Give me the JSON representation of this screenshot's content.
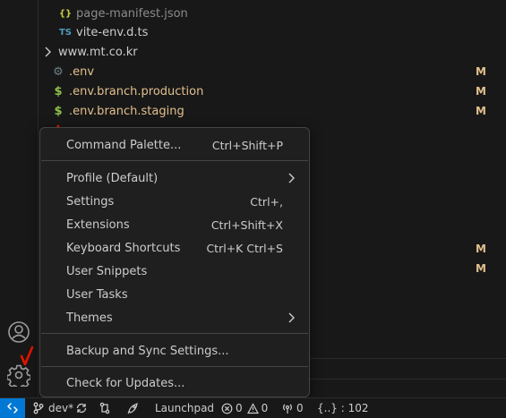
{
  "explorer": {
    "files": [
      {
        "name": "page-manifest.json",
        "icon": "json-icon",
        "icon_glyph": "{}",
        "icon_color": "#cbcb41"
      },
      {
        "name": "vite-env.d.ts",
        "icon": "typescript-icon",
        "icon_glyph": "TS",
        "icon_color": "#519aba"
      },
      {
        "name": "www.mt.co.kr",
        "icon": "chevron-right-icon",
        "icon_glyph": ">"
      },
      {
        "name": ".env",
        "icon": "gear-icon",
        "icon_glyph": "⚙",
        "icon_color": "#6d8086",
        "badge": "M"
      },
      {
        "name": ".env.branch.production",
        "icon": "dollar-icon",
        "icon_glyph": "$",
        "icon_color": "#8dc149",
        "badge": "M"
      },
      {
        "name": ".env.branch.staging",
        "icon": "dollar-icon",
        "icon_glyph": "$",
        "icon_color": "#8dc149",
        "badge": "M"
      }
    ],
    "hidden_badges": [
      "M",
      "M"
    ]
  },
  "menu": {
    "items": [
      {
        "label": "Command Palette...",
        "shortcut": "Ctrl+Shift+P"
      },
      {
        "label": "Profile (Default)",
        "submenu": true
      },
      {
        "label": "Settings",
        "shortcut": "Ctrl+,"
      },
      {
        "label": "Extensions",
        "shortcut": "Ctrl+Shift+X"
      },
      {
        "label": "Keyboard Shortcuts",
        "shortcut": "Ctrl+K Ctrl+S"
      },
      {
        "label": "User Snippets"
      },
      {
        "label": "User Tasks"
      },
      {
        "label": "Themes",
        "submenu": true
      },
      {
        "label": "Backup and Sync Settings..."
      },
      {
        "label": "Check for Updates..."
      }
    ]
  },
  "status_bar": {
    "branch": "dev*",
    "launchpad": "Launchpad",
    "errors": "0",
    "warnings": "0",
    "ports": "0",
    "braces": "{..} : 102"
  },
  "colors": {
    "accent": "#0078d4",
    "annotation_red": "#e51400",
    "modified": "#e2c08d"
  }
}
